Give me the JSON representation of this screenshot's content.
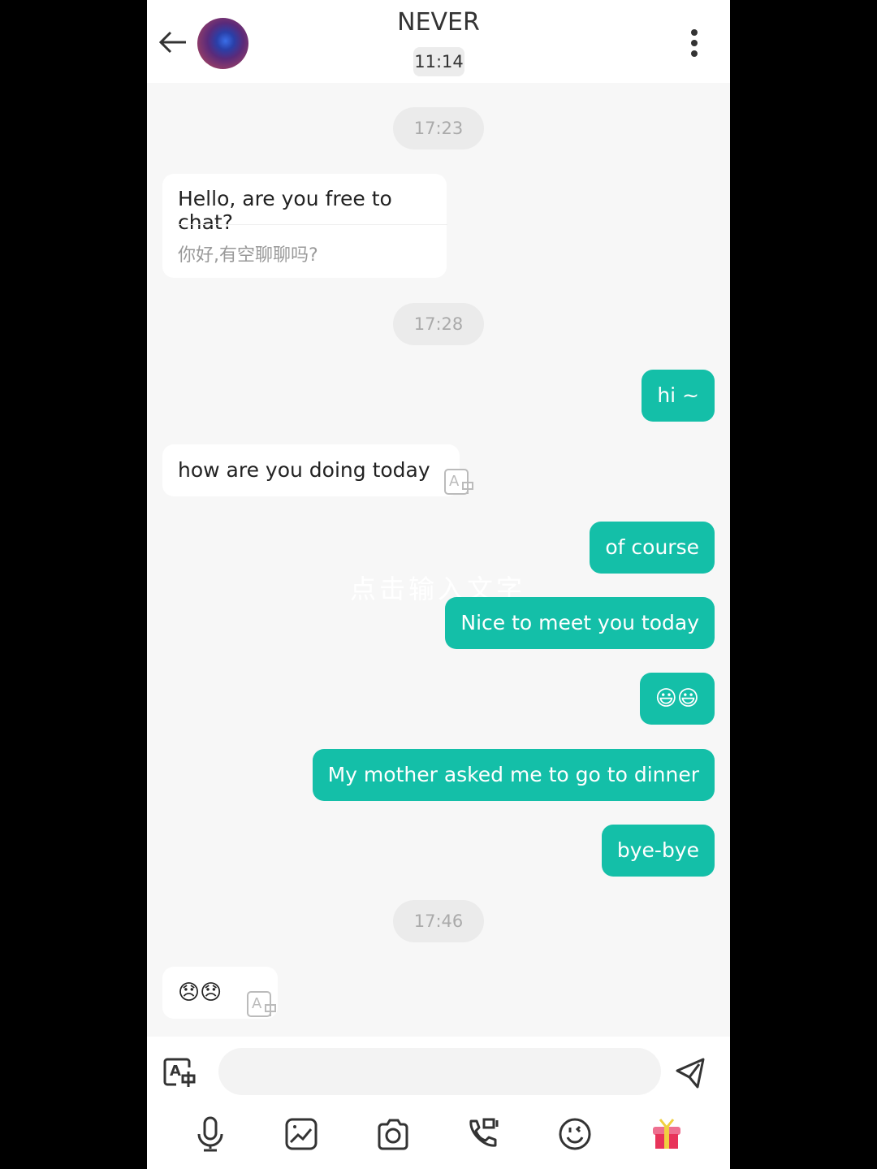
{
  "header": {
    "title": "NEVER",
    "time": "11:14"
  },
  "messages": [
    {
      "type": "timestamp",
      "text": "17:23"
    },
    {
      "type": "incoming",
      "text": "Hello, are you free to chat?",
      "translation": "你好,有空聊聊吗?"
    },
    {
      "type": "timestamp",
      "text": "17:28"
    },
    {
      "type": "outgoing",
      "text": "hi ~"
    },
    {
      "type": "incoming",
      "text": "how are you doing today"
    },
    {
      "type": "outgoing",
      "text": "of course"
    },
    {
      "type": "outgoing",
      "text": "Nice to meet you today"
    },
    {
      "type": "outgoing",
      "text": "😃😃"
    },
    {
      "type": "outgoing",
      "text": "My mother asked me to go to dinner"
    },
    {
      "type": "outgoing",
      "text": "bye-bye"
    },
    {
      "type": "timestamp",
      "text": "17:46"
    },
    {
      "type": "incoming",
      "text": "😞😞"
    }
  ],
  "watermark": "点击输入文字",
  "input": {
    "value": "",
    "placeholder": ""
  },
  "colors": {
    "accent": "#14bfa8",
    "background": "#f7f7f7"
  },
  "toolbar": [
    "microphone-icon",
    "image-icon",
    "camera-icon",
    "video-call-icon",
    "emoji-icon",
    "gift-icon"
  ]
}
